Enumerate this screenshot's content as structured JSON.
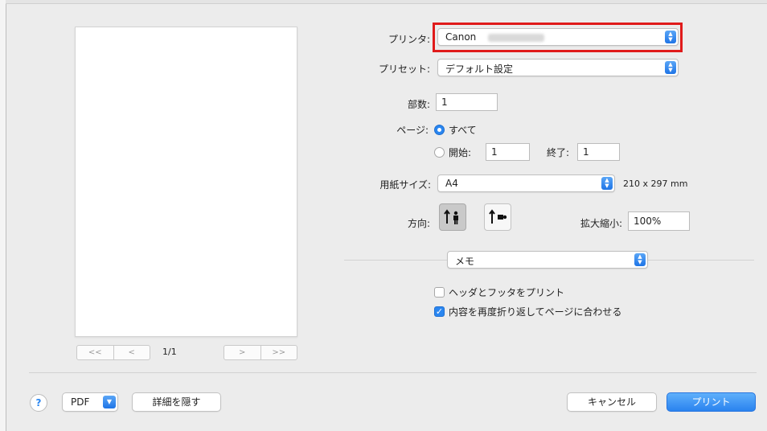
{
  "printer": {
    "label": "プリンタ:",
    "value": "Canon",
    "model_blurred": "TS-8000 S"
  },
  "preset": {
    "label": "プリセット:",
    "value": "デフォルト設定"
  },
  "copies": {
    "label": "部数:",
    "value": "1"
  },
  "pages": {
    "label": "ページ:",
    "all_label": "すべて",
    "from_label": "開始:",
    "from_value": "1",
    "to_label": "終了:",
    "to_value": "1"
  },
  "paper_size": {
    "label": "用紙サイズ:",
    "value": "A4",
    "dimensions": "210 x 297 mm"
  },
  "orientation": {
    "label": "方向:"
  },
  "scale": {
    "label": "拡大縮小:",
    "value": "100%"
  },
  "section_menu": {
    "value": "メモ"
  },
  "options": [
    {
      "label": "ヘッダとフッタをプリント",
      "checked": false
    },
    {
      "label": "内容を再度折り返してページに合わせる",
      "checked": true
    }
  ],
  "preview_nav": {
    "first": "<<",
    "prev": "<",
    "next": ">",
    "last": ">>",
    "page_indicator": "1/1"
  },
  "footer": {
    "help": "?",
    "pdf_label": "PDF",
    "hide_details": "詳細を隠す",
    "cancel": "キャンセル",
    "print": "プリント"
  },
  "colors": {
    "accent": "#2a86f0",
    "highlight_border": "#e01b1b"
  }
}
